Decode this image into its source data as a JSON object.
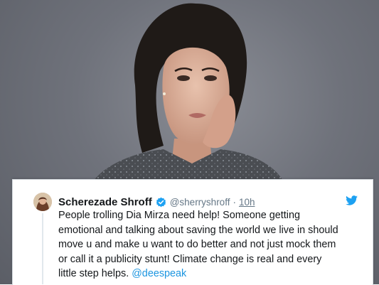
{
  "tweet": {
    "display_name": "Scherezade Shroff",
    "handle": "@sherryshroff",
    "separator": "·",
    "time": "10h",
    "lines": [
      "People trolling Dia Mirza need help! Someone getting",
      "emotional and talking about saving the world we live in should",
      "move u and make u want to do better and not just mock them",
      "or call it a publicity stunt! Climate change is real and every",
      "little step helps."
    ],
    "mention": "@deespeak"
  },
  "colors": {
    "link": "#1b95e0",
    "verified": "#1da1f2",
    "text": "#14171a",
    "muted": "#657786"
  },
  "icons": {
    "verified": "verified-badge-icon",
    "brand": "twitter-bird-icon"
  }
}
